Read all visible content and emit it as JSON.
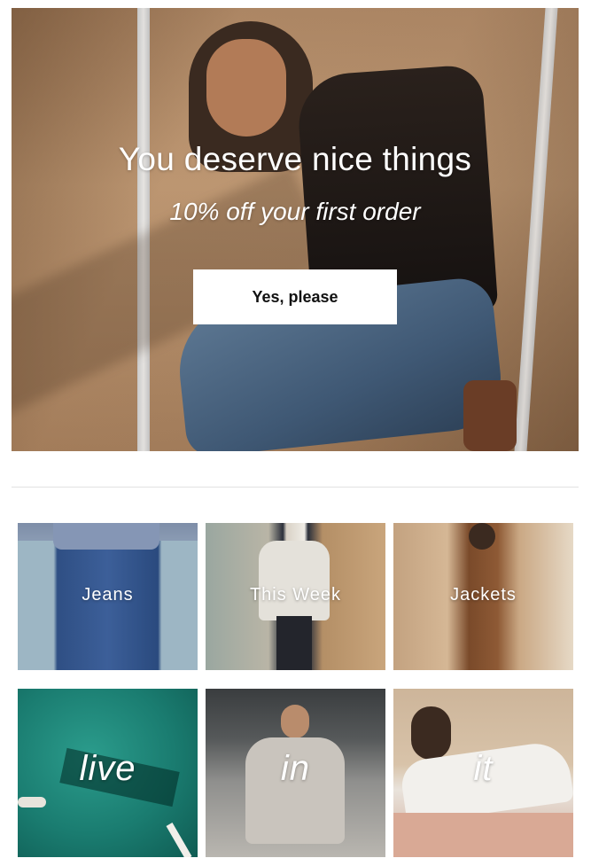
{
  "hero": {
    "title": "You deserve nice things",
    "subtitle": "10% off your first order",
    "cta_label": "Yes, please"
  },
  "categories": [
    {
      "label": "Jeans"
    },
    {
      "label": "This Week"
    },
    {
      "label": "Jackets"
    }
  ],
  "campaign": [
    {
      "label": "live"
    },
    {
      "label": "in"
    },
    {
      "label": "it"
    }
  ],
  "colors": {
    "background": "#ffffff",
    "text_on_image": "#ffffff",
    "cta_background": "#ffffff",
    "cta_text": "#111111",
    "divider": "#e2e2e2"
  }
}
